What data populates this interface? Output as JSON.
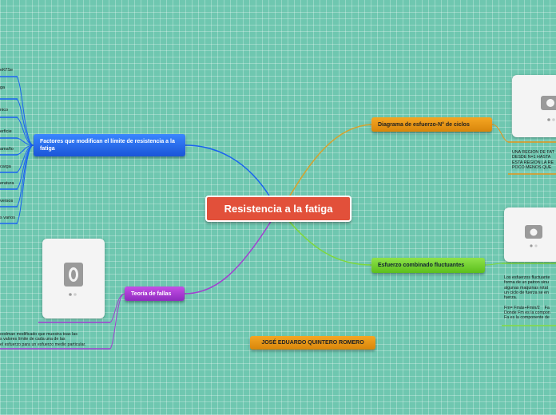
{
  "central": {
    "title": "Resistencia a la fatiga"
  },
  "branches": {
    "factors": {
      "title": "Factores que modifican el límite de resistencia a la fatiga",
      "leaves": [
        "eKf'Se",
        "ga",
        "nico",
        "erficie",
        "amaño",
        "carga",
        "eratura",
        "versos",
        "s varios"
      ]
    },
    "diagram": {
      "title": "Diagrama de esfuerzo-N° de ciclos",
      "note": "UNA REGION DE FAT\nDESDE N=1 HASTA \nESTA REGION LA RE\nPOCO MENOS QUE "
    },
    "combined": {
      "title": "Esfuerzo combinado fluctuantes",
      "note": "Los esfuerzos fluctuante\nforma de un patron sinu\nalgunas maquinas rotat\nun ciclo de fuerza se en\nfuerza.\n\nFm= Fmáx+Fmin/2    Fa\nDonde Fm es la compon\nFa es la componente de"
    },
    "theory": {
      "title": "Teoría de fallas",
      "note": "oodman modificado que muestra toas las\ns valores límite de cada una de las\nel esfuerzo para un esfuerzo medio particular."
    },
    "author": {
      "title": "JOSÉ EDUARDO QUINTERO ROMERO"
    }
  },
  "colors": {
    "central": "#e2503a",
    "blue": "#1a62f0",
    "orange": "#e8951a",
    "green": "#7fd83a",
    "purple": "#a23fd0",
    "background": "#6fc7b0"
  }
}
